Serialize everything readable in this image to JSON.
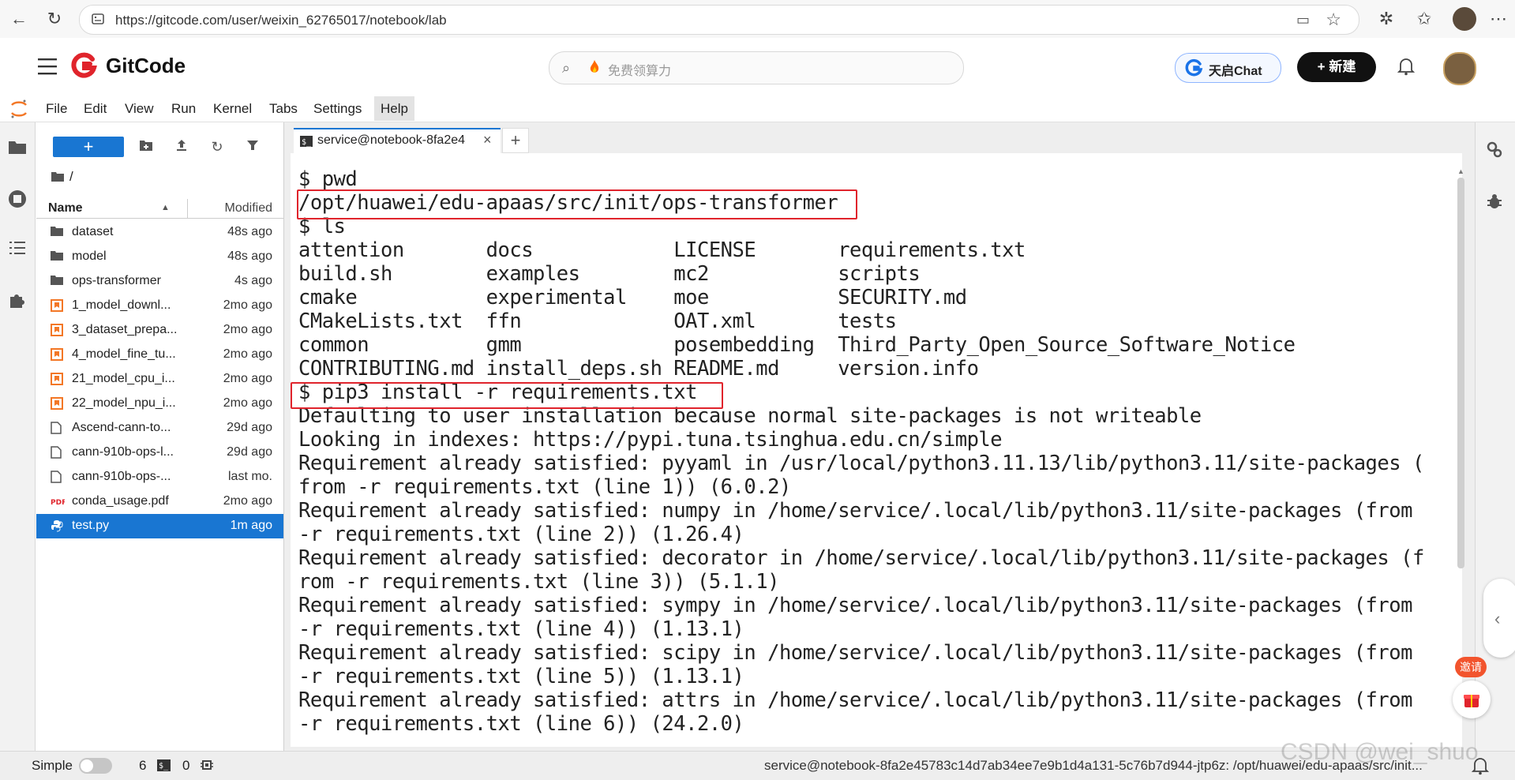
{
  "browser": {
    "url": "https://gitcode.com/user/weixin_62765017/notebook/lab"
  },
  "header": {
    "brand": "GitCode",
    "search_placeholder": "免费领算力",
    "chat_label": "天启Chat",
    "new_label": "+ 新建"
  },
  "menu": {
    "items": [
      "File",
      "Edit",
      "View",
      "Run",
      "Kernel",
      "Tabs",
      "Settings",
      "Help"
    ]
  },
  "filebrowser": {
    "path": "/",
    "col_name": "Name",
    "col_modified": "Modified",
    "files": [
      {
        "name": "dataset",
        "modified": "48s ago",
        "kind": "folder"
      },
      {
        "name": "model",
        "modified": "48s ago",
        "kind": "folder"
      },
      {
        "name": "ops-transformer",
        "modified": "4s ago",
        "kind": "folder"
      },
      {
        "name": "1_model_downl...",
        "modified": "2mo ago",
        "kind": "notebook"
      },
      {
        "name": "3_dataset_prepa...",
        "modified": "2mo ago",
        "kind": "notebook"
      },
      {
        "name": "4_model_fine_tu...",
        "modified": "2mo ago",
        "kind": "notebook"
      },
      {
        "name": "21_model_cpu_i...",
        "modified": "2mo ago",
        "kind": "notebook"
      },
      {
        "name": "22_model_npu_i...",
        "modified": "2mo ago",
        "kind": "notebook"
      },
      {
        "name": "Ascend-cann-to...",
        "modified": "29d ago",
        "kind": "file"
      },
      {
        "name": "cann-910b-ops-l...",
        "modified": "29d ago",
        "kind": "file"
      },
      {
        "name": "cann-910b-ops-...",
        "modified": "last mo.",
        "kind": "file"
      },
      {
        "name": "conda_usage.pdf",
        "modified": "2mo ago",
        "kind": "pdf"
      },
      {
        "name": "test.py",
        "modified": "1m ago",
        "kind": "python",
        "selected": true
      }
    ]
  },
  "terminal": {
    "tab_label": "service@notebook-8fa2e4",
    "lines": [
      "$ pwd",
      "/opt/huawei/edu-apaas/src/init/ops-transformer",
      "$ ls",
      "attention       docs            LICENSE       requirements.txt",
      "build.sh        examples        mc2           scripts",
      "cmake           experimental    moe           SECURITY.md",
      "CMakeLists.txt  ffn             OAT.xml       tests",
      "common          gmm             posembedding  Third_Party_Open_Source_Software_Notice",
      "CONTRIBUTING.md install_deps.sh README.md     version.info",
      "$ pip3 install -r requirements.txt",
      "Defaulting to user installation because normal site-packages is not writeable",
      "Looking in indexes: https://pypi.tuna.tsinghua.edu.cn/simple",
      "Requirement already satisfied: pyyaml in /usr/local/python3.11.13/lib/python3.11/site-packages (",
      "from -r requirements.txt (line 1)) (6.0.2)",
      "Requirement already satisfied: numpy in /home/service/.local/lib/python3.11/site-packages (from",
      "-r requirements.txt (line 2)) (1.26.4)",
      "Requirement already satisfied: decorator in /home/service/.local/lib/python3.11/site-packages (f",
      "rom -r requirements.txt (line 3)) (5.1.1)",
      "Requirement already satisfied: sympy in /home/service/.local/lib/python3.11/site-packages (from",
      "-r requirements.txt (line 4)) (1.13.1)",
      "Requirement already satisfied: scipy in /home/service/.local/lib/python3.11/site-packages (from",
      "-r requirements.txt (line 5)) (1.13.1)",
      "Requirement already satisfied: attrs in /home/service/.local/lib/python3.11/site-packages (from",
      "-r requirements.txt (line 6)) (24.2.0)"
    ]
  },
  "statusbar": {
    "mode_label": "Simple",
    "terminals_count": "6",
    "kernels_count": "0",
    "right_text": "service@notebook-8fa2e45783c14d7ab34ee7e9b1d4a131-5c76b7d944-jtp6z: /opt/huawei/edu-apaas/src/init..."
  },
  "floating": {
    "invite_label": "邀请"
  },
  "watermark": "CSDN @wei_shuo",
  "colors": {
    "accent": "#1976d2",
    "brand_red": "#e0242c",
    "highlight_box": "#e0242c"
  }
}
